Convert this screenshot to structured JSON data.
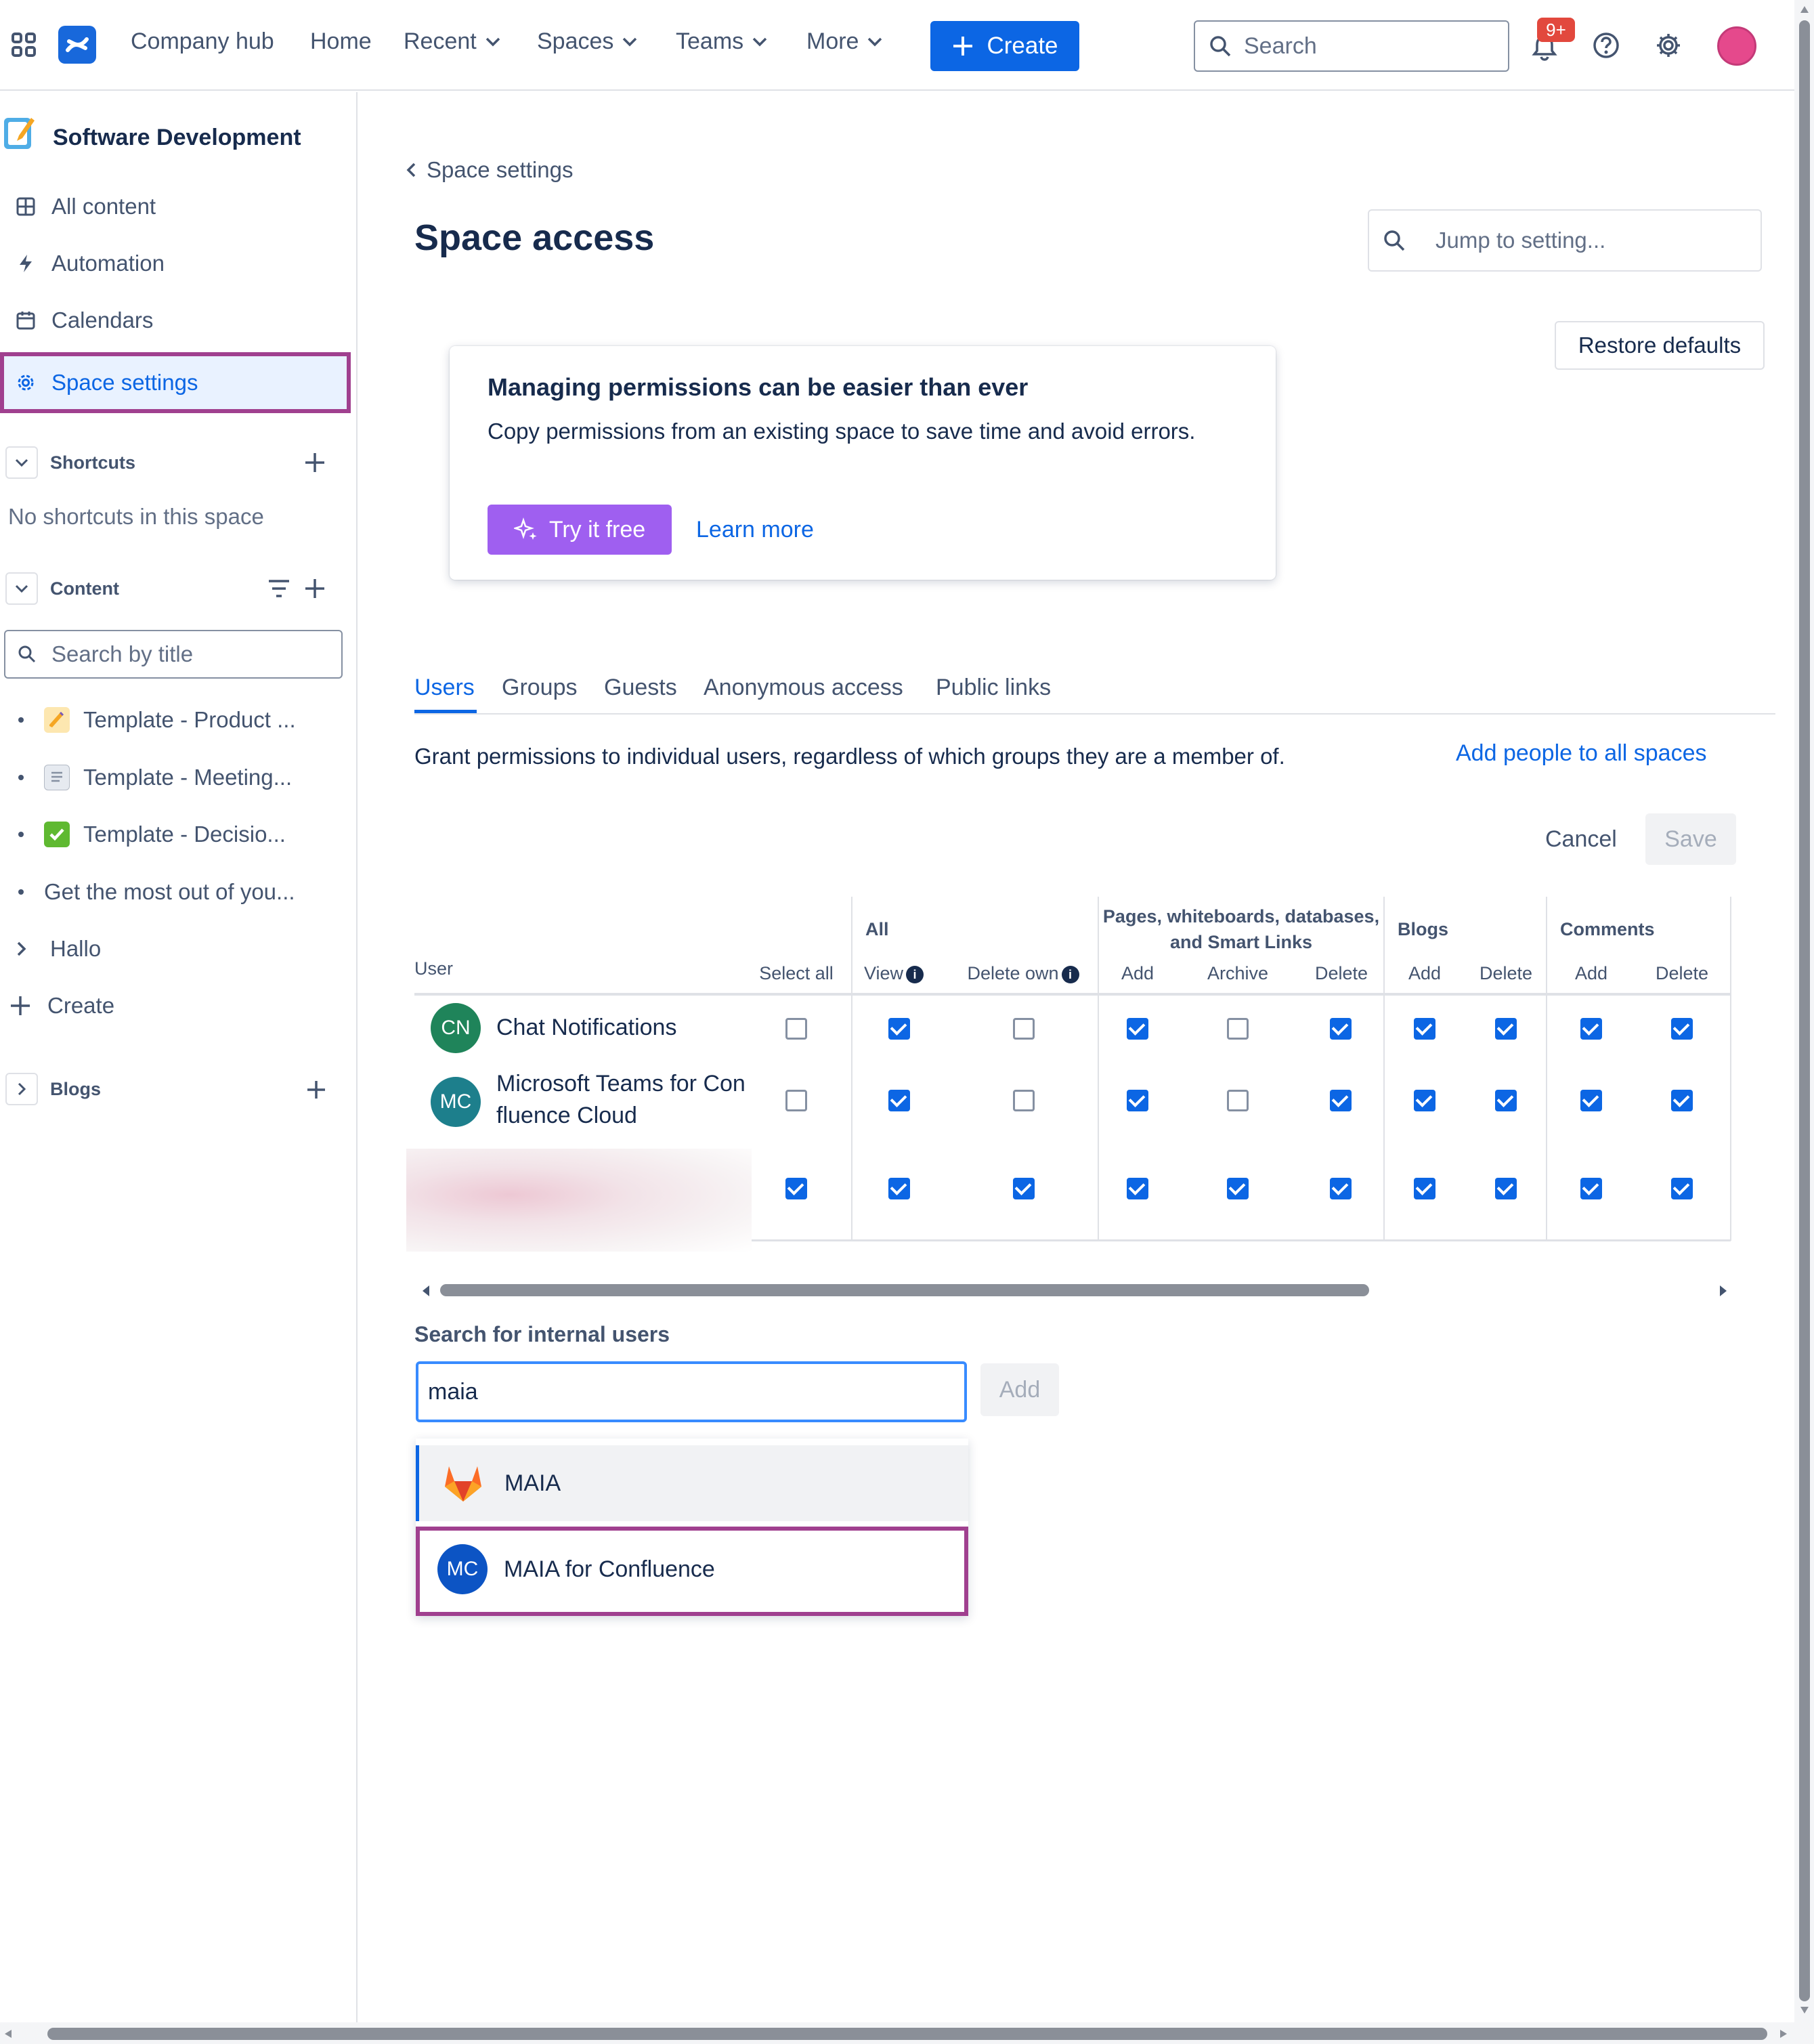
{
  "topbar": {
    "hub_label": "Company hub",
    "home_label": "Home",
    "recent_label": "Recent",
    "spaces_label": "Spaces",
    "teams_label": "Teams",
    "more_label": "More",
    "create_label": "Create",
    "search_placeholder": "Search",
    "notifications_count": "9+"
  },
  "sidebar": {
    "space_name": "Software Development",
    "items": [
      {
        "label": "All content",
        "icon": "grid-icon"
      },
      {
        "label": "Automation",
        "icon": "lightning-icon"
      },
      {
        "label": "Calendars",
        "icon": "calendar-icon"
      },
      {
        "label": "Space settings",
        "icon": "gear-icon"
      }
    ],
    "shortcuts_title": "Shortcuts",
    "shortcuts_empty": "No shortcuts in this space",
    "content_title": "Content",
    "search_placeholder": "Search by title",
    "tree": [
      {
        "label": "Template - Product ...",
        "icon": "pencil-emoji"
      },
      {
        "label": "Template - Meeting...",
        "icon": "notepad-emoji"
      },
      {
        "label": "Template - Decisio...",
        "icon": "check-emoji"
      },
      {
        "label": "Get the most out of you...",
        "icon": "none"
      }
    ],
    "hallo_label": "Hallo",
    "create_label": "Create",
    "blogs_title": "Blogs"
  },
  "main": {
    "breadcrumb": "Space settings",
    "title": "Space access",
    "jump_placeholder": "Jump to setting...",
    "restore_label": "Restore defaults",
    "promo": {
      "title": "Managing permissions can be easier than ever",
      "body": "Copy permissions from an existing space to save time and avoid errors.",
      "try_label": "Try it free",
      "learn_label": "Learn more"
    },
    "tabs": [
      "Users",
      "Groups",
      "Guests",
      "Anonymous access",
      "Public links"
    ],
    "description": "Grant permissions to individual users, regardless of which groups they are a member of.",
    "add_all_label": "Add people to all spaces",
    "cancel_label": "Cancel",
    "save_label": "Save",
    "table": {
      "group_headers": {
        "all": "All",
        "pages": "Pages, whiteboards, databases, and Smart Links",
        "blogs": "Blogs",
        "comments": "Comments"
      },
      "columns": [
        "User",
        "Select all",
        "View",
        "Delete own",
        "Add",
        "Archive",
        "Delete",
        "Add",
        "Delete",
        "Add",
        "Delete"
      ],
      "rows": [
        {
          "initials": "CN",
          "name": "Chat Notifications",
          "color": "#1f845a",
          "checks": [
            false,
            true,
            false,
            true,
            false,
            true,
            true,
            true,
            true,
            true
          ]
        },
        {
          "initials": "MC",
          "name": "Microsoft Teams for Confluence Cloud",
          "color": "#1d7f8c",
          "checks": [
            false,
            true,
            false,
            true,
            false,
            true,
            true,
            true,
            true,
            true
          ]
        },
        {
          "initials": "",
          "name": "",
          "color": "#e9c6d2",
          "checks": [
            true,
            true,
            true,
            true,
            true,
            true,
            true,
            true,
            true,
            true
          ]
        }
      ]
    },
    "search_users_label": "Search for internal users",
    "search_users_value": "maia",
    "add_label": "Add",
    "suggestions": [
      {
        "label": "MAIA",
        "icon": "gitlab-fox-icon"
      },
      {
        "label": "MAIA for Confluence",
        "initials": "MC"
      }
    ]
  }
}
